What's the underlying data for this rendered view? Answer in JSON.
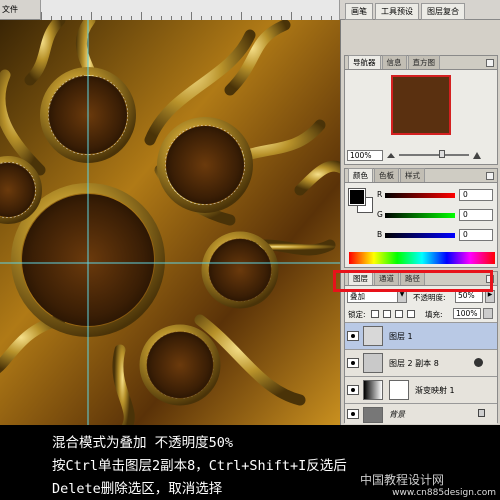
{
  "topbar": {
    "menu_fragment": "文件",
    "dock_tabs": [
      "画笔",
      "工具预设",
      "图层复合"
    ]
  },
  "navigator": {
    "tabs": [
      "导航器",
      "信息",
      "直方图"
    ],
    "zoom": "100%"
  },
  "color": {
    "tabs": [
      "颜色",
      "色板",
      "样式"
    ],
    "channels": [
      {
        "label": "R",
        "value": "0"
      },
      {
        "label": "G",
        "value": "0"
      },
      {
        "label": "B",
        "value": "0"
      }
    ]
  },
  "layers": {
    "tabs": [
      "图层",
      "通道",
      "路径"
    ],
    "blend_mode": "叠加",
    "opacity_label": "不透明度:",
    "opacity": "50%",
    "lock_label": "锁定:",
    "fill_label": "填充:",
    "fill": "100%",
    "items": [
      {
        "name": "图层 1",
        "selected": true
      },
      {
        "name": "图层 2 副本 8",
        "selected": false
      },
      {
        "name": "渐变映射 1",
        "selected": false
      },
      {
        "name": "背景",
        "selected": false
      }
    ]
  },
  "caption": {
    "line1": "混合模式为叠加 不透明度50%",
    "line2": "按Ctrl单击图层2副本8，Ctrl+Shift+I反选后",
    "line3": "Delete删除选区，取消选择"
  },
  "watermark": {
    "cn": "中国教程设计网",
    "url": "www.cn885design.com"
  },
  "colors": {
    "panel_bg": "#d4d0c8",
    "highlight": "#e8121a",
    "gold": "#b8860b"
  }
}
